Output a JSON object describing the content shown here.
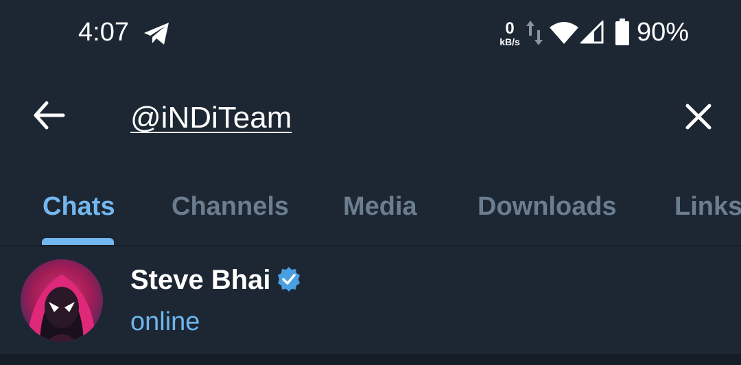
{
  "status_bar": {
    "time": "4:07",
    "net_speed_value": "0",
    "net_speed_unit": "kB/s",
    "battery": "90%",
    "icons": [
      "telegram-icon",
      "data-arrows-icon",
      "wifi-icon",
      "signal-icon",
      "battery-icon"
    ]
  },
  "search": {
    "query_prefix": "@",
    "query_user": "iNDiTeam",
    "back_icon": "arrow-left-icon",
    "clear_icon": "close-icon"
  },
  "tabs": [
    {
      "label": "Chats",
      "active": true
    },
    {
      "label": "Channels",
      "active": false
    },
    {
      "label": "Media",
      "active": false
    },
    {
      "label": "Downloads",
      "active": false
    },
    {
      "label": "Links",
      "active": false
    }
  ],
  "results": [
    {
      "name": "Steve Bhai",
      "verified": true,
      "status": "online"
    }
  ],
  "colors": {
    "background": "#1d2733",
    "accent": "#73b7f0",
    "tab_inactive": "#6b7e90",
    "verified": "#4a9fe0"
  }
}
